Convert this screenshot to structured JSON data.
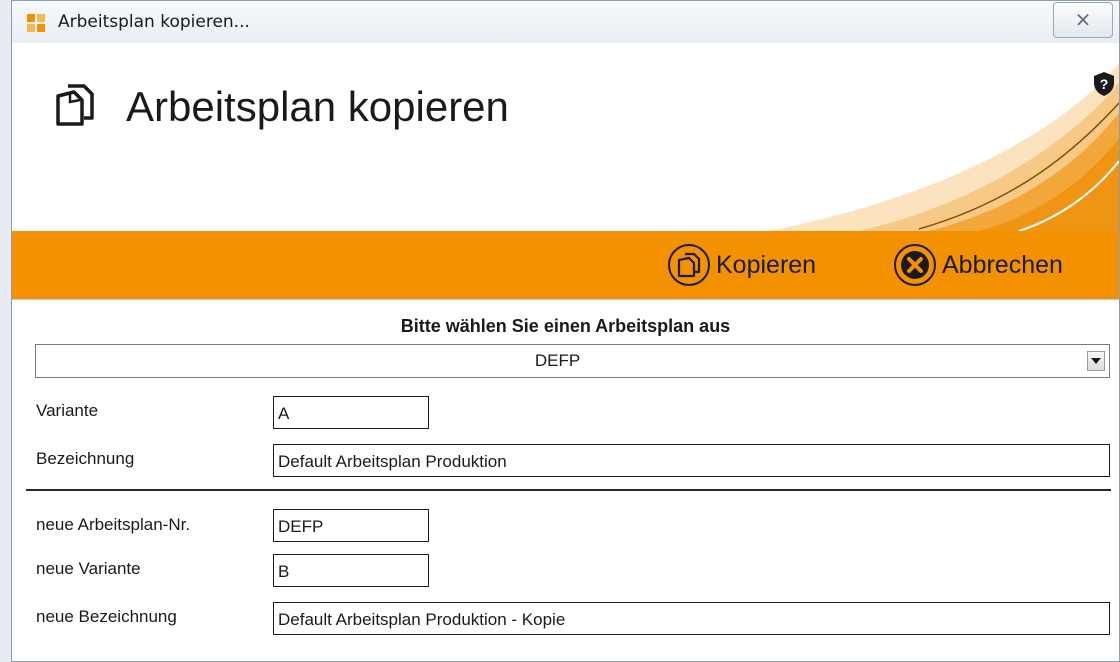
{
  "window": {
    "title": "Arbeitsplan kopieren...",
    "close_glyph": "⨯"
  },
  "header": {
    "title": "Arbeitsplan kopieren",
    "icon": "copy-document-icon",
    "help_icon": "shield-question-icon"
  },
  "toolbar": {
    "accent_color": "#f39100",
    "copy_label": "Kopieren",
    "cancel_label": "Abbrechen"
  },
  "form": {
    "prompt": "Bitte wählen Sie einen Arbeitsplan aus",
    "plan_select": {
      "value": "DEFP"
    },
    "variante": {
      "label": "Variante",
      "value": "A"
    },
    "bezeichnung": {
      "label": "Bezeichnung",
      "value": "Default Arbeitsplan Produktion"
    },
    "neue_nr": {
      "label": "neue Arbeitsplan-Nr.",
      "value": "DEFP"
    },
    "neue_variante": {
      "label": "neue Variante",
      "value": "B"
    },
    "neue_bezeichnung": {
      "label": "neue Bezeichnung",
      "value": "Default Arbeitsplan Produktion - Kopie"
    }
  }
}
